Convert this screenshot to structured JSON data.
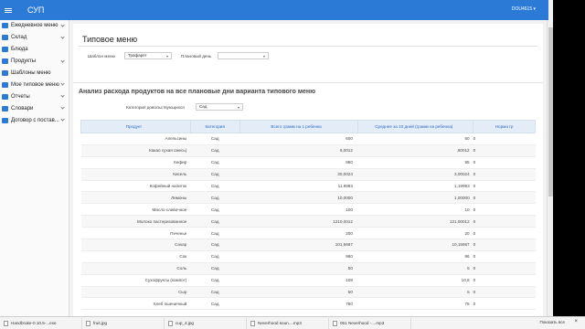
{
  "app": {
    "title": "СУП",
    "user": "DOU4615 ▾"
  },
  "sidebar": {
    "items": [
      {
        "label": "Ежедневное меню",
        "chevron": true
      },
      {
        "label": "Склад",
        "chevron": true
      },
      {
        "label": "Блюда",
        "chevron": false
      },
      {
        "label": "Продукты",
        "chevron": true
      },
      {
        "label": "Шаблоны меню",
        "chevron": false
      },
      {
        "label": "Мое типовое меню",
        "chevron": true
      },
      {
        "label": "Отчеты",
        "chevron": true
      },
      {
        "label": "Словари",
        "chevron": true
      },
      {
        "label": "Договор с постав...",
        "chevron": true
      }
    ]
  },
  "page": {
    "title": "Типовое меню",
    "template_label": "Шаблон меню",
    "template_value": "Трафарет",
    "day_label": "Плановый день",
    "day_value": ""
  },
  "analysis": {
    "title": "Анализ расхода продуктов на все плановые дни варианта типового меню",
    "category_label": "Категория довольствующихся",
    "category_value": "Сад"
  },
  "table": {
    "headers": [
      "Продукт",
      "Категория",
      "Всего грамм на 1 ребенка",
      "Среднее за 10 дней (грамм на ребенка)",
      "Норма гр"
    ],
    "rows": [
      [
        "Апельсины",
        "Сад",
        "600",
        "60",
        "0"
      ],
      [
        "Какао сухая смесь)",
        "Сад",
        "6,0012",
        ",60012",
        "0"
      ],
      [
        "Кефир",
        "Сад",
        "950",
        "95",
        "0"
      ],
      [
        "Кисель",
        "Сад",
        "30,0024",
        "3,00024",
        "0"
      ],
      [
        "Кофейный напиток",
        "Сад",
        "11,9993",
        "1,19993",
        "0"
      ],
      [
        "Лимоны",
        "Сад",
        "10,0000",
        "1,00000",
        "0"
      ],
      [
        "Масло сливочное",
        "Сад",
        "100",
        "10",
        "0"
      ],
      [
        "Молоко пастеризованное",
        "Сад",
        "1210,0012",
        "121,00012",
        "0"
      ],
      [
        "Печенье",
        "Сад",
        "200",
        "20",
        "0"
      ],
      [
        "Сахар",
        "Сад",
        "101,5667",
        "10,15667",
        "0"
      ],
      [
        "Сок",
        "Сад",
        "960",
        "96",
        "0"
      ],
      [
        "Соль",
        "Сад",
        "50",
        "5",
        "0"
      ],
      [
        "Сухофрукты (компот)",
        "Сад",
        "108",
        "10,8",
        "0"
      ],
      [
        "Сыр",
        "Сад",
        "50",
        "5",
        "0"
      ],
      [
        "Хлеб пшеничный",
        "Сад",
        "750",
        "75",
        "0"
      ]
    ]
  },
  "downloads": {
    "items": [
      "Handbrake-0.10.5-...exe",
      "fruit.jpg",
      "cup_4.jpg",
      "Neverhood soun....mp3",
      "051 Neverhood -....mp3"
    ],
    "show_all": "Показать все",
    "close": "×"
  },
  "colors": {
    "accent": "#2a7ad6",
    "header_bg": "#e4ecf7"
  }
}
